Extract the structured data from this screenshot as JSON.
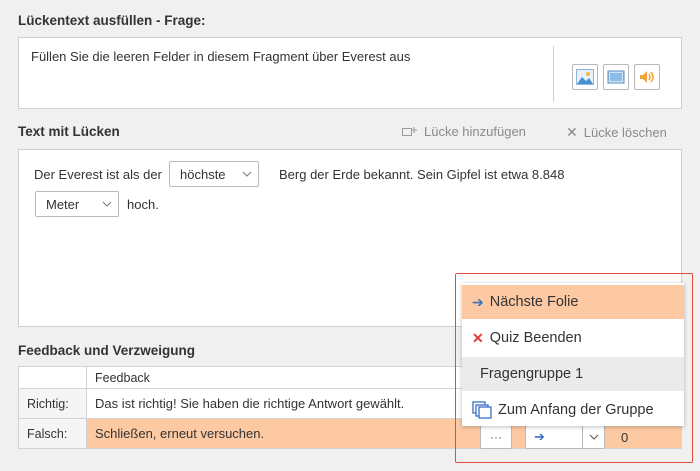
{
  "question_section": {
    "title": "Lückentext ausfüllen - Frage:",
    "question_text": "Füllen Sie die leeren Felder in diesem Fragment über Everest aus",
    "media_icons": [
      "image-icon",
      "video-icon",
      "audio-icon"
    ]
  },
  "gap_section": {
    "title": "Text mit Lücken",
    "add_gap_label": "Lücke hinzufügen",
    "delete_gap_label": "Lücke löschen",
    "text_part1": "Der Everest ist als der",
    "gap1_value": "höchste",
    "text_part2": "Berg der Erde bekannt. Sein Gipfel ist etwa 8.848",
    "gap2_value": "Meter",
    "text_part3": "hoch."
  },
  "feedback_section": {
    "title": "Feedback und Verzweigung",
    "column_feedback": "Feedback",
    "rows": [
      {
        "label": "Richtig:",
        "feedback": "Das ist richtig! Sie haben die richtige Antwort gewählt."
      },
      {
        "label": "Falsch:",
        "feedback": "Schließen, erneut versuchen.",
        "more_label": "···",
        "branch_value": "➔",
        "score": "0"
      }
    ]
  },
  "branch_menu": {
    "items": [
      {
        "label": "Nächste Folie",
        "icon": "arrow-right-icon",
        "state": "selected"
      },
      {
        "label": "Quiz Beenden",
        "icon": "close-icon"
      },
      {
        "label": "Fragengruppe 1",
        "icon": "",
        "state": "hover"
      },
      {
        "label": "Zum Anfang der Gruppe",
        "icon": "group-icon"
      }
    ]
  },
  "colors": {
    "highlight": "#fcc9a3",
    "accent_red": "#e34b3a",
    "arrow_blue": "#3a6fc2"
  }
}
